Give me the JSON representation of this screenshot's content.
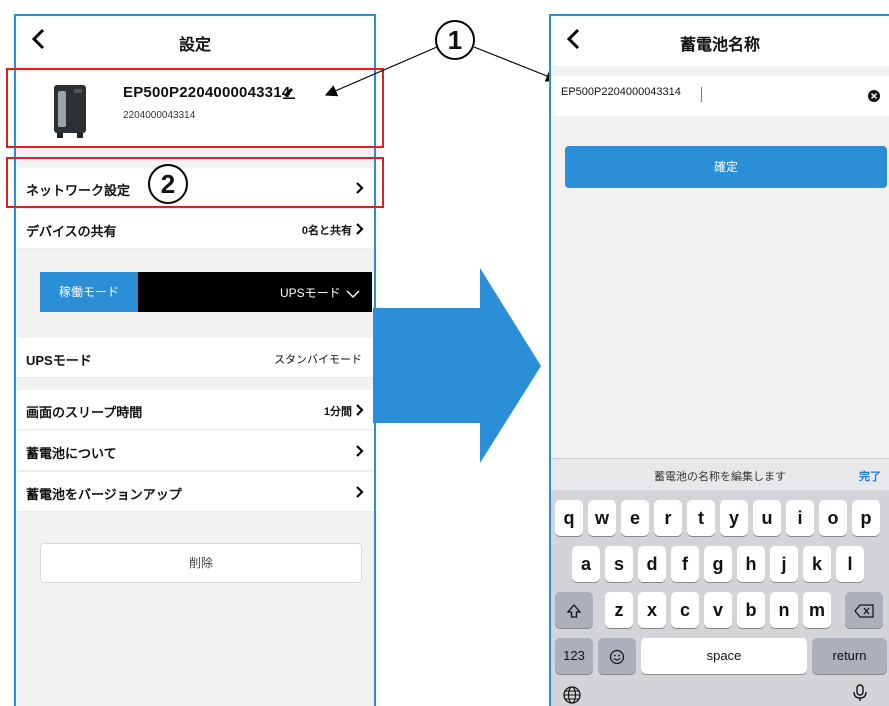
{
  "left_screen": {
    "title": "設定",
    "device": {
      "name": "EP500P2204000043314",
      "serial": "2204000043314"
    },
    "rows": {
      "network": "ネットワーク設定",
      "sharing": "デバイスの共有",
      "sharing_value": "0名と共有",
      "ups_mode": "UPSモード",
      "ups_mode_value": "スタンバイモード",
      "sleep": "画面のスリープ時間",
      "sleep_value": "1分間",
      "about": "蓄電池について",
      "upgrade": "蓄電池をバージョンアップ"
    },
    "mode_bar": {
      "tab_label": "稼働モード",
      "selected": "UPSモード"
    },
    "delete_label": "削除"
  },
  "right_screen": {
    "title": "蓄電池名称",
    "name_value": "EP500P2204000043314",
    "confirm_label": "確定",
    "keyboard": {
      "hint": "蓄電池の名称を編集します",
      "done_label": "完了",
      "row1": [
        "q",
        "w",
        "e",
        "r",
        "t",
        "y",
        "u",
        "i",
        "o",
        "p"
      ],
      "row2": [
        "a",
        "s",
        "d",
        "f",
        "g",
        "h",
        "j",
        "k",
        "l"
      ],
      "row3": [
        "z",
        "x",
        "c",
        "v",
        "b",
        "n",
        "m"
      ],
      "numbers_key": "123",
      "space_key": "space",
      "return_key": "return"
    }
  },
  "callouts": {
    "one": "1",
    "two": "2"
  },
  "colors": {
    "accent": "#2a8fd6",
    "highlight": "#e02020",
    "mode_bar_bg": "#000000"
  },
  "icons": [
    "back-chevron-icon",
    "pencil-icon",
    "chevron-right-icon",
    "chevron-down-icon",
    "clear-circle-icon",
    "shift-icon",
    "backspace-icon",
    "emoji-icon",
    "globe-icon",
    "microphone-icon"
  ]
}
